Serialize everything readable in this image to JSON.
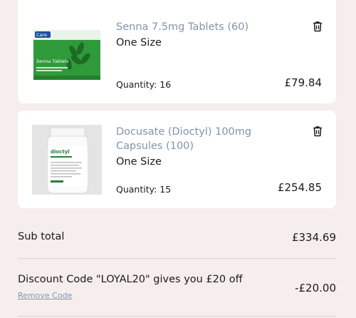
{
  "cart": {
    "items": [
      {
        "name": "Senna 7.5mg Tablets (60)",
        "size": "One Size",
        "quantity": "Quantity: 16",
        "price": "£79.84",
        "image": "senna-tablets-box-image",
        "pack_brand": "Care",
        "pack_title": "Senna Tablets"
      },
      {
        "name": "Docusate (Dioctyl) 100mg Capsules (100)",
        "size": "One Size",
        "quantity": "Quantity: 15",
        "price": "£254.85",
        "image": "dioctyl-capsules-bottle-image",
        "bottle_label": "dioctyl"
      }
    ]
  },
  "summary": {
    "subtotal_label": "Sub total",
    "subtotal_value": "£334.69",
    "discount_label": "Discount Code \"LOYAL20\" gives you £20 off",
    "discount_value": "-£20.00",
    "remove_code": "Remove Code"
  },
  "colors": {
    "background": "#f6eeec",
    "card": "#ffffff",
    "product_name": "#8094ad",
    "pack_green": "#2f9a3a",
    "pack_blue": "#1f4f9c"
  },
  "icons": {
    "delete": "trash-icon"
  }
}
